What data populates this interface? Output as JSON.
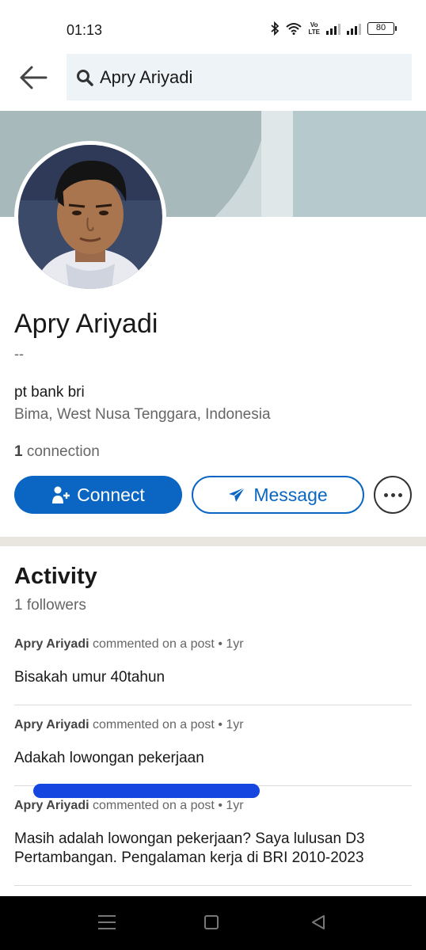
{
  "status_bar": {
    "time": "01:13",
    "volte_label": "Vo\nLTE",
    "battery": "80",
    "icons": [
      "bluetooth-icon",
      "wifi-icon",
      "volte-icon",
      "signal-icon",
      "signal-icon",
      "battery-icon"
    ]
  },
  "header": {
    "search_query": "Apry Ariyadi",
    "icons": [
      "back-arrow-icon",
      "search-icon"
    ]
  },
  "profile": {
    "name": "Apry Ariyadi",
    "headline": "--",
    "company": "pt bank bri",
    "location": "Bima, West Nusa Tenggara, Indonesia",
    "connections_count": "1",
    "connections_label": "connection"
  },
  "actions": {
    "connect_label": "Connect",
    "message_label": "Message",
    "icons": [
      "add-person-icon",
      "send-icon",
      "more-icon"
    ]
  },
  "activity": {
    "title": "Activity",
    "followers": "1 followers",
    "items": [
      {
        "author": "Apry Ariyadi",
        "action": "commented on a post",
        "time": "1yr",
        "text": "Bisakah umur 40tahun"
      },
      {
        "author": "Apry Ariyadi",
        "action": "commented on a post",
        "time": "1yr",
        "text": "Adakah lowongan pekerjaan"
      },
      {
        "author": "Apry Ariyadi",
        "action": "commented on a post",
        "time": "1yr",
        "text": "Masih adalah lowongan pekerjaan? Saya lulusan D3 Pertambangan. Pengalaman kerja di BRI 2010-2023"
      }
    ],
    "separator": "•"
  },
  "colors": {
    "brand_blue": "#0a66c2",
    "search_bg": "#eef3f8",
    "scribble": "#1546e0"
  },
  "nav_bar": {
    "icons": [
      "menu-icon",
      "home-icon",
      "back-icon"
    ]
  }
}
